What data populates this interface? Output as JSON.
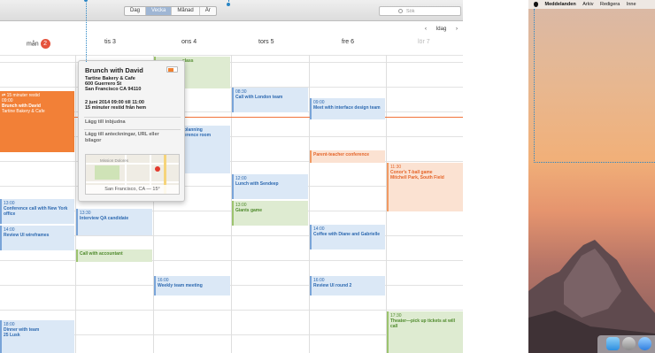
{
  "toolbar": {
    "views": [
      "Dag",
      "Vecka",
      "Månad",
      "År"
    ],
    "active_view": "Vecka",
    "search_placeholder": "Sök"
  },
  "nav": {
    "prev": "‹",
    "today": "Idag",
    "next": "›"
  },
  "days": [
    {
      "label": "mån",
      "badge": "2"
    },
    {
      "label": "tis 3"
    },
    {
      "label": "ons 4"
    },
    {
      "label": "tors 5"
    },
    {
      "label": "fre 6"
    },
    {
      "label": "lör 7"
    }
  ],
  "events": {
    "travel": "15 minuter restid",
    "brunch_time": "09:00",
    "brunch_title": "Brunch with David",
    "brunch_place": "Tartine Bakery & Cafe",
    "class": "class",
    "london_time": "08:30",
    "london": "Call with London team",
    "interface_time": "09:00",
    "interface": "Meet with interface design team",
    "planning_1": "planning",
    "planning_2": "erence room",
    "parent": "Parent-teacher conference",
    "tball_time": "11:30",
    "tball_title": "Conor's T-ball game",
    "tball_place": "Mitchell Park, South Field",
    "ny_time": "13:00",
    "ny": "Conference call with New York office",
    "lunch_time": "12:00",
    "lunch": "Lunch with Sendeep",
    "giants_time": "13:00",
    "giants": "Giants game",
    "qa_time": "13:30",
    "qa": "Interview QA candidate",
    "wire_time": "14:00",
    "wire": "Review UI wireframes",
    "coffee_time": "14:00",
    "coffee": "Coffee with Diane and Gabrielle",
    "accountant": "Call with accountant",
    "weekly_time": "16:00",
    "weekly": "Weekly team meeting",
    "ui2_time": "16:00",
    "ui2": "Review UI round 2",
    "dinner_time": "18:00",
    "dinner_title": "Dinner with team",
    "dinner_place": "25 Lusk",
    "theater_time": "17:30",
    "theater": "Theater—pick up tickets at will call"
  },
  "popover": {
    "title": "Brunch with David",
    "address": [
      "Tartine Bakery & Cafe",
      "600 Guerrero St",
      "San Francisco CA 94110"
    ],
    "when": "2 juni 2014  09:00 till 11:00",
    "travel": "15 minuter restid från hem",
    "invitees": "Lägg till inbjudna",
    "notes": "Lägg till anteckningar, URL eller bilagor",
    "map_district": "Mission Dolores",
    "map_caption": "San Francisco, CA — 15°",
    "color": "#f08030"
  },
  "menubar": {
    "app": "Meddelanden",
    "items": [
      "Arkiv",
      "Redigera",
      "Inne"
    ]
  },
  "colors": {
    "accent": "#2a86c5",
    "today_badge": "#e5533d",
    "now_line": "#f1743a"
  }
}
